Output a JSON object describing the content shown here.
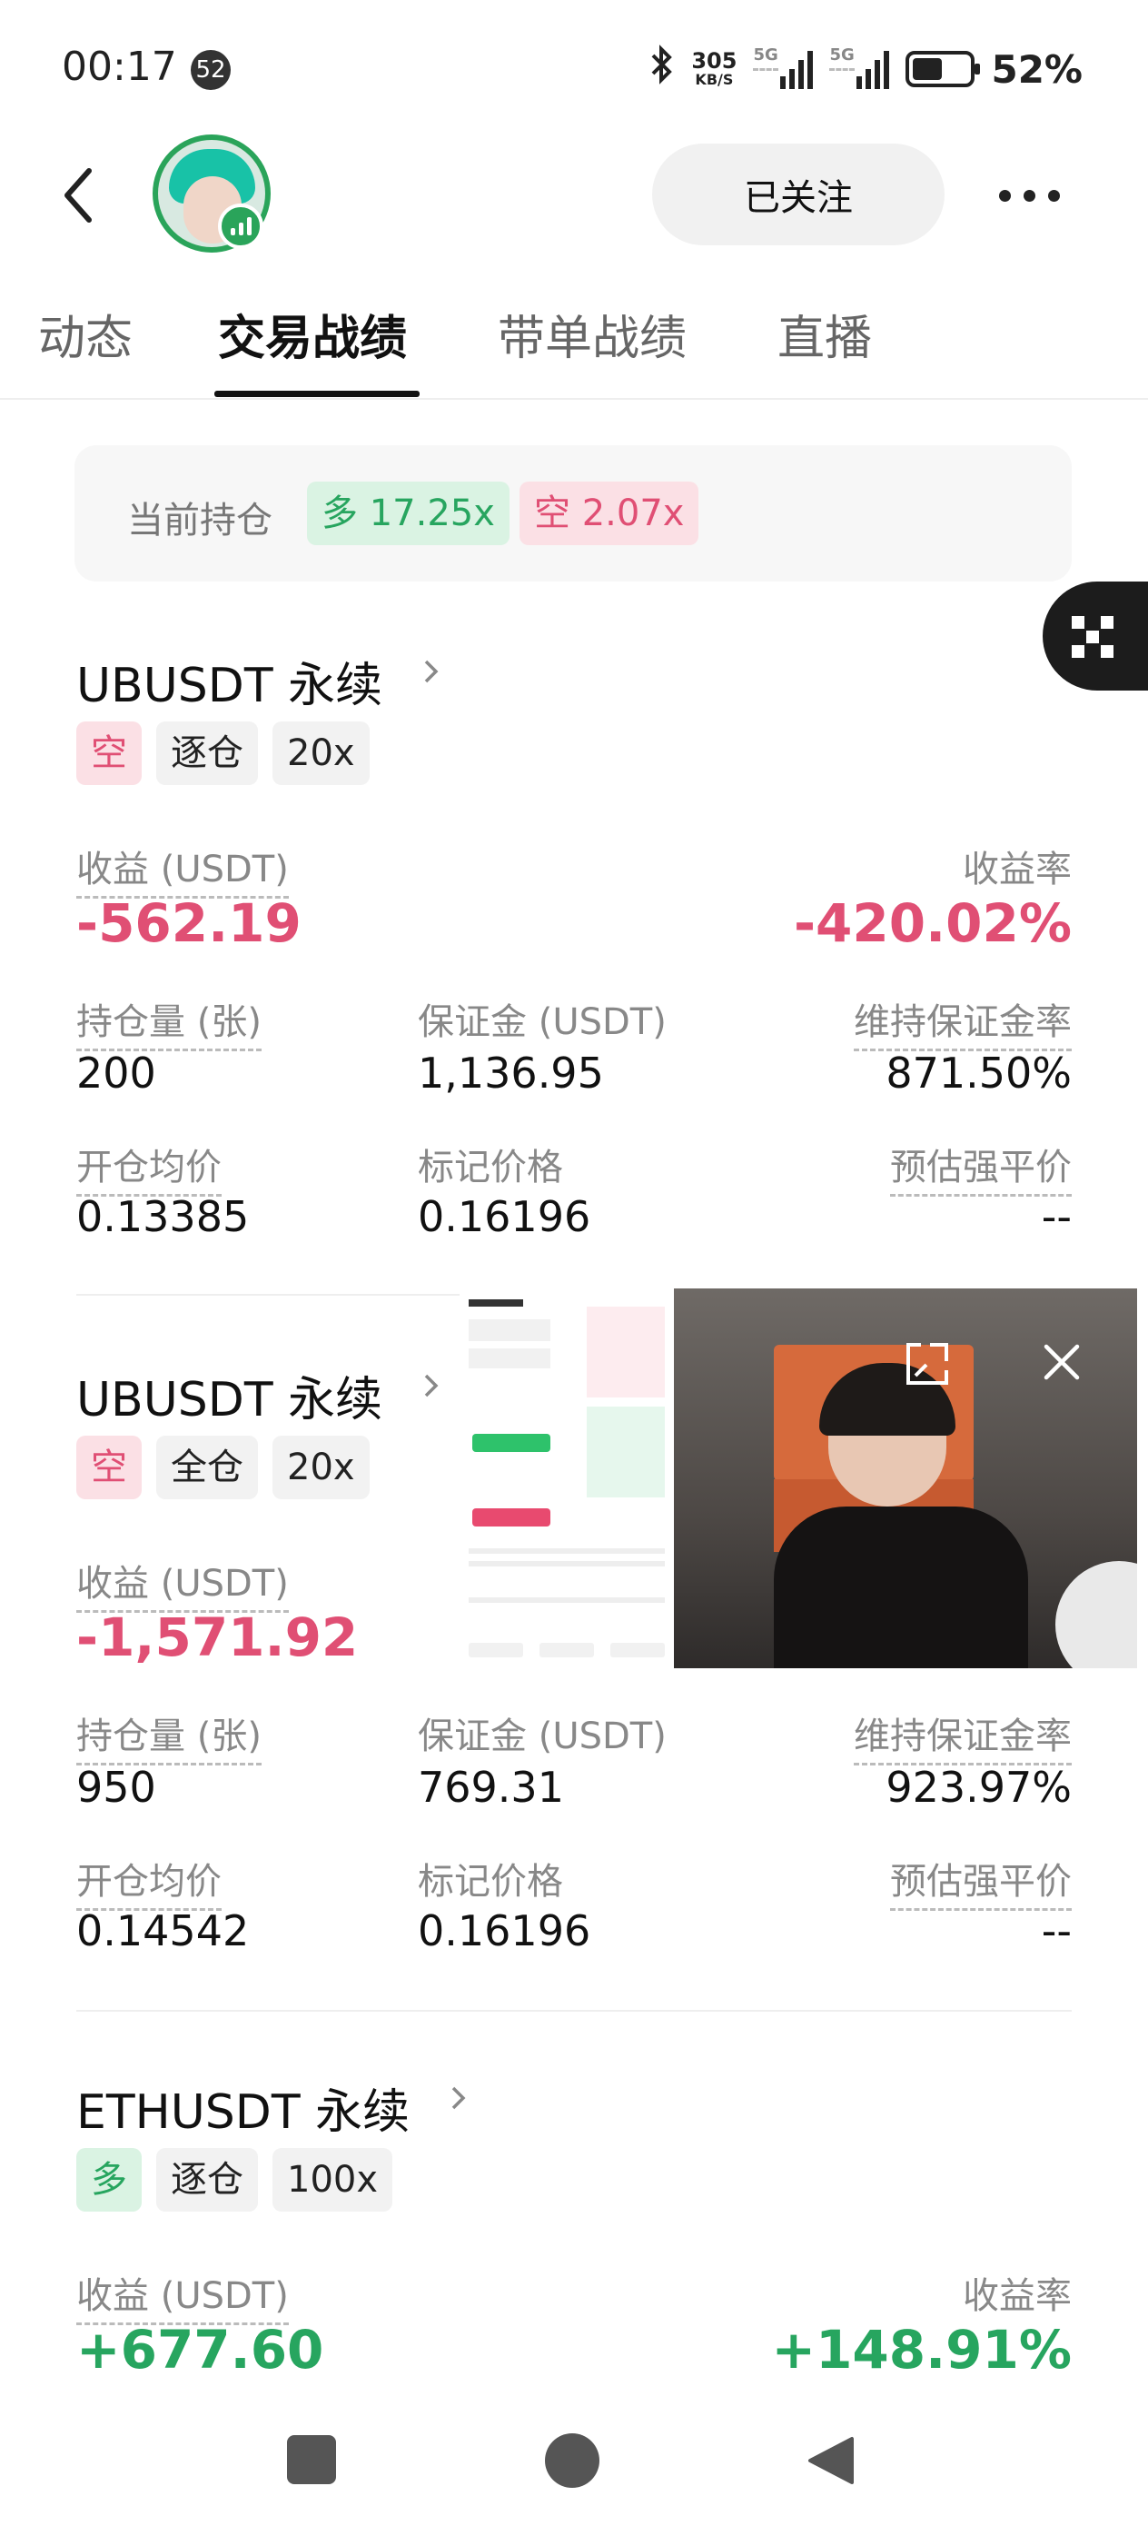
{
  "status_bar": {
    "time": "00:17",
    "notification_count": "52",
    "net_speed": "305",
    "net_speed_unit": "KB/S",
    "signal1_label": "5G",
    "signal2_label": "5G",
    "battery_percent": "52%",
    "battery_level": 0.52,
    "icons": [
      "bluetooth-icon",
      "signal-icon",
      "signal-icon",
      "battery-icon"
    ]
  },
  "header": {
    "back_icon": "chevron-left-icon",
    "follow_label": "已关注",
    "more_icon": "more-dots-icon"
  },
  "tabs": [
    {
      "label": "动态",
      "active": false
    },
    {
      "label": "交易战绩",
      "active": true
    },
    {
      "label": "带单战绩",
      "active": false
    },
    {
      "label": "直播",
      "active": false
    }
  ],
  "summary": {
    "label": "当前持仓",
    "long": "多 17.25x",
    "short": "空 2.07x"
  },
  "labels": {
    "pnl": "收益 (USDT)",
    "pnl_rate": "收益率",
    "qty": "持仓量 (张)",
    "margin": "保证金 (USDT)",
    "mmr": "维持保证金率",
    "entry": "开仓均价",
    "mark": "标记价格",
    "liq": "预估强平价"
  },
  "positions": [
    {
      "symbol": "UBUSDT 永续",
      "side": "空",
      "margin_mode": "逐仓",
      "leverage": "20x",
      "pnl": "-562.19",
      "pnl_rate": "-420.02%",
      "qty": "200",
      "margin": "1,136.95",
      "mmr": "871.50%",
      "entry": "0.13385",
      "mark": "0.16196",
      "liq": "--"
    },
    {
      "symbol": "UBUSDT 永续",
      "side": "空",
      "margin_mode": "全仓",
      "leverage": "20x",
      "pnl": "-1,571.92",
      "qty": "950",
      "margin": "769.31",
      "mmr": "923.97%",
      "entry": "0.14542",
      "mark": "0.16196",
      "liq": "--"
    },
    {
      "symbol": "ETHUSDT 永续",
      "side": "多",
      "margin_mode": "逐仓",
      "leverage": "100x",
      "pnl": "+677.60",
      "pnl_rate": "+148.91%"
    }
  ],
  "pip": {
    "expand_icon": "expand-icon",
    "close_icon": "close-icon"
  },
  "colors": {
    "accent_green": "#27a55f",
    "accent_red": "#e04f74"
  },
  "navbar": {
    "icons": [
      "recent-apps-icon",
      "home-icon",
      "back-icon"
    ]
  }
}
